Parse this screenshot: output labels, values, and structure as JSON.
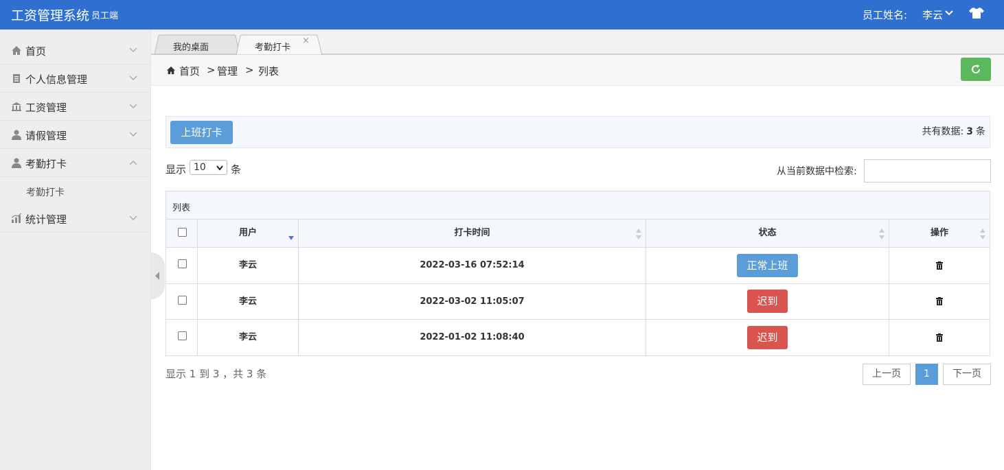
{
  "header": {
    "title": "工资管理系统",
    "subtitle": "员工端",
    "user_label": "员工姓名:",
    "user_name": "李云"
  },
  "sidebar": {
    "items": [
      {
        "label": "首页",
        "icon": "home-icon"
      },
      {
        "label": "个人信息管理",
        "icon": "clipboard-icon"
      },
      {
        "label": "工资管理",
        "icon": "bank-icon"
      },
      {
        "label": "请假管理",
        "icon": "user-icon"
      },
      {
        "label": "考勤打卡",
        "icon": "user-icon",
        "expanded": true
      },
      {
        "label": "统计管理",
        "icon": "bar-chart-icon"
      }
    ],
    "subitems": [
      {
        "label": "考勤打卡",
        "parent": "考勤打卡"
      }
    ]
  },
  "tabs": [
    {
      "label": "我的桌面"
    },
    {
      "label": "考勤打卡",
      "active": true,
      "close": "×"
    }
  ],
  "breadcrumb": {
    "items": [
      "首页",
      "管理",
      "列表"
    ],
    "separator": ">"
  },
  "actions": {
    "checkin_label": "上班打卡",
    "total_prefix": "共有数据:",
    "total_count": "3",
    "total_suffix": "条"
  },
  "length": {
    "prefix": "显示",
    "value": "10",
    "suffix": "条"
  },
  "search": {
    "label": "从当前数据中检索:",
    "value": ""
  },
  "table": {
    "caption": "列表",
    "columns": [
      "用户",
      "打卡时间",
      "状态",
      "操作"
    ],
    "rows": [
      {
        "user": "李云",
        "time": "2022-03-16 07:52:14",
        "status": "正常上班",
        "status_color": "#5b9dd9"
      },
      {
        "user": "李云",
        "time": "2022-03-02 11:05:07",
        "status": "迟到",
        "status_color": "#d9534f"
      },
      {
        "user": "李云",
        "time": "2022-01-02 11:08:40",
        "status": "迟到",
        "status_color": "#d9534f"
      }
    ]
  },
  "footer": {
    "info": "显示 1 到 3 ，共 3 条",
    "prev": "上一页",
    "page": "1",
    "next": "下一页"
  },
  "colors": {
    "header_bg": "#2f6fcf",
    "primary": "#5b9dd9",
    "success": "#5cb85c",
    "danger": "#d9534f"
  }
}
